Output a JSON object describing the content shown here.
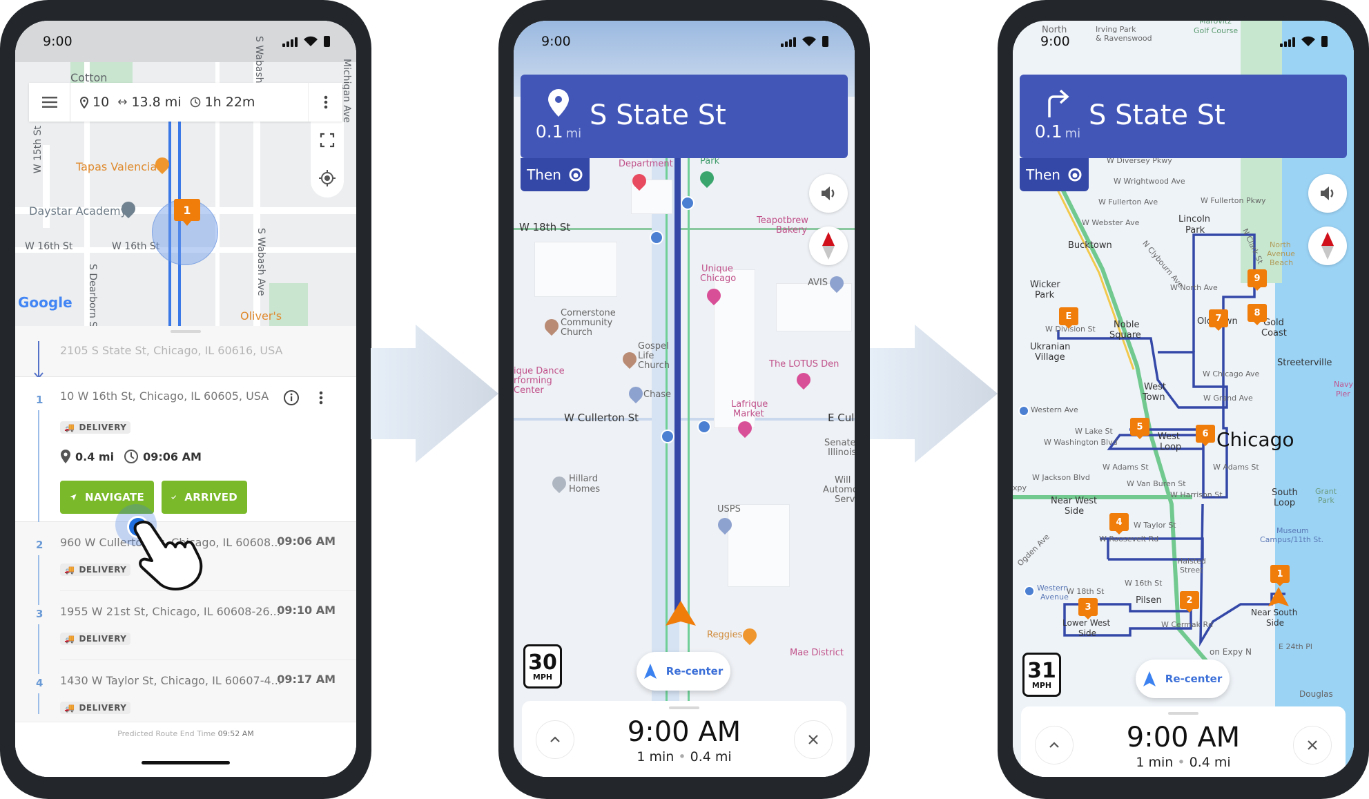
{
  "status_bar": {
    "time": "9:00"
  },
  "phone1": {
    "map_labels": {
      "cotton": "Cotton",
      "s_wabash_top": "S Wabash",
      "michigan_ave": "Michigan Ave",
      "w_15th": "W 15th St",
      "tapas": "Tapas Valencia",
      "daystar": "Daystar Academy",
      "w_16th_a": "W 16th St",
      "w_16th_b": "W 16th St",
      "s_dearborn": "S Dearborn St",
      "s_wabash_ave": "S Wabash Ave",
      "olivers": "Oliver's",
      "google": "Google"
    },
    "marker_label": "1",
    "toolbar": {
      "stops": "10",
      "distance": "13.8 mi",
      "duration": "1h 22m"
    },
    "start_address": "2105 S State St, Chicago, IL 60616, USA",
    "stops": [
      {
        "number": "1",
        "address": "10 W 16th St, Chicago, IL 60605, USA",
        "type": "DELIVERY",
        "distance": "0.4 mi",
        "time": "09:06 AM"
      },
      {
        "number": "2",
        "address": "960 W Cullerton St, Chicago, IL 60608...",
        "type": "DELIVERY",
        "time": "09:06 AM"
      },
      {
        "number": "3",
        "address": "1955 W 21st St, Chicago, IL 60608-26...",
        "type": "DELIVERY",
        "time": "09:10 AM"
      },
      {
        "number": "4",
        "address": "1430 W Taylor St, Chicago, IL 60607-4...",
        "type": "DELIVERY",
        "time": "09:17 AM"
      }
    ],
    "buttons": {
      "navigate": "NAVIGATE",
      "arrived": "ARRIVED"
    },
    "footer": {
      "label": "Predicted Route End Time",
      "time": "09:52 AM"
    }
  },
  "phone2": {
    "banner": {
      "distance": "0.1",
      "unit": "mi",
      "street": "S State St",
      "maneuver_icon": "destination-pin-icon"
    },
    "then_label": "Then",
    "speed_limit": {
      "value": "30",
      "unit": "MPH"
    },
    "recenter": "Re-center",
    "eta": {
      "time": "9:00 AM",
      "duration": "1 min",
      "distance": "0.4 mi"
    },
    "map_labels": {
      "police": "Department",
      "park": "Park",
      "w18th": "W 18th St",
      "teapot1": "Teapotbrew",
      "teapot2": "Bakery",
      "unique1": "Unique",
      "unique2": "Chicago",
      "avis": "AVIS",
      "corner1": "Cornerstone",
      "corner2": "Community",
      "corner3": "Church",
      "gospel1": "Gospel",
      "gospel2": "Life",
      "gospel3": "Church",
      "dance1": "ique Dance",
      "dance2": "rforming",
      "dance3": "Center",
      "chase": "Chase",
      "lotus": "The LOTUS Den",
      "lafrique1": "Lafrique",
      "lafrique2": "Market",
      "w_cullerton": "W Cullerton St",
      "e_cull": "E Cull",
      "senate1": "Senate-",
      "senate2": "Illinois",
      "will1": "Will",
      "will2": "Automot",
      "will3": "Serv",
      "hillard1": "Hillard",
      "hillard2": "Homes",
      "usps": "USPS",
      "reggies": "Reggies",
      "mae": "Mae District"
    }
  },
  "phone3": {
    "banner": {
      "distance": "0.1",
      "unit": "mi",
      "street": "S State St",
      "maneuver_icon": "turn-right-icon"
    },
    "then_label": "Then",
    "speed_limit": {
      "value": "31",
      "unit": "MPH"
    },
    "recenter": "Re-center",
    "eta": {
      "time": "9:00 AM",
      "duration": "1 min",
      "distance": "0.4 mi"
    },
    "markers": [
      "E",
      "9",
      "8",
      "7",
      "6",
      "5",
      "4",
      "3",
      "2",
      "1"
    ],
    "map_labels": {
      "north": "North",
      "irving1": "Irving Park",
      "irving2": "& Ravenswood",
      "golf1": "Marovitz",
      "golf2": "Golf Course",
      "diversey": "W Diversey Pkwy",
      "wrightwood": "W Wrightwood Ave",
      "fullerton": "W Fullerton Ave",
      "fullerton_pkwy": "W Fullerton Pkwy",
      "webster": "W Webster Ave",
      "lincoln1": "Lincoln",
      "lincoln2": "Park",
      "bucktown": "Bucktown",
      "clybourn": "N Clybourn Ave",
      "clark": "N Clark St",
      "nab1": "North",
      "nab2": "Avenue",
      "nab3": "Beach",
      "wicker1": "Wicker",
      "wicker2": "Park",
      "north_ave": "W North Ave",
      "division": "W Division St",
      "noble1": "Noble",
      "noble2": "Square",
      "oldtown": "Old Town",
      "gold1": "Gold",
      "gold2": "Coast",
      "ukr1": "Ukranian",
      "ukr2": "Village",
      "streeterville": "Streeterville",
      "chicago_ave": "W Chicago Ave",
      "west_town1": "West",
      "west_town2": "Town",
      "grand": "W Grand Ave",
      "navy1": "Navy",
      "navy2": "Pier",
      "western": "Western Ave",
      "lake": "W Lake St",
      "washington": "W Washington Blvd",
      "west_loop1": "West",
      "west_loop2": "Loop",
      "chicago": "Chicago",
      "adams_w": "W Adams St",
      "adams_e": "W Adams St",
      "jackson": "W Jackson Blvd",
      "van_buren": "W Van Buren St",
      "harrison": "W Harrison St",
      "south_loop1": "South",
      "south_loop2": "Loop",
      "grant1": "Grant",
      "grant2": "Park",
      "near_west1": "Near West",
      "near_west2": "Side",
      "taylor": "W Taylor St",
      "roosevelt": "W Roosevelt Rd",
      "museum1": "Museum",
      "museum2": "Campus/11th St.",
      "halsted1": "Halsted",
      "halsted2": "Street",
      "w16th": "W 16th St",
      "w18th": "W 18th St",
      "western_av1": "Western",
      "western_av2": "Avenue",
      "pilsen": "Pilsen",
      "lws1": "Lower West",
      "lws2": "Side",
      "cermak": "W Cermak Rd",
      "nss1": "Near South",
      "nss2": "Side",
      "expy": "on Expy N",
      "e24": "E 24th Pl",
      "douglas": "Douglas",
      "xpy": "xpy",
      "ogden": "Ogden Ave"
    }
  }
}
